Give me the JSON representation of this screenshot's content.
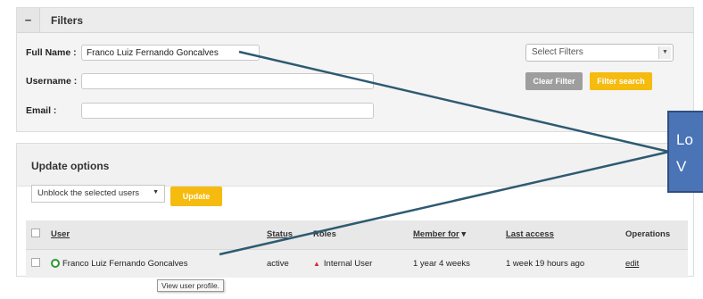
{
  "filters": {
    "title": "Filters",
    "toggle": "−",
    "full_name_label": "Full Name :",
    "full_name_value": "Franco Luiz Fernando Goncalves",
    "username_label": "Username :",
    "username_value": "",
    "email_label": "Email :",
    "email_value": "",
    "select_filters": "Select Filters",
    "clear_filter": "Clear Filter",
    "filter_search": "Filter search"
  },
  "update": {
    "title": "Update options",
    "action_selected": "Unblock the selected users",
    "update_button": "Update"
  },
  "table": {
    "headers": [
      "User",
      "Status",
      "Roles",
      "Member for",
      "Last access",
      "Operations"
    ],
    "rows": [
      {
        "user": "Franco Luiz Fernando Goncalves",
        "status": "active",
        "role": "Internal User",
        "member_for": "1 year 4 weeks",
        "last_access": "1 week 19 hours ago",
        "operation": "edit"
      }
    ]
  },
  "tooltip": "View user profile.",
  "callout": {
    "line1": "Lo",
    "line2": "V"
  },
  "colors": {
    "accent": "#f6bb0f",
    "callout": "#4a74b6",
    "arrow": "#2e5a72",
    "status_active": "#2b9a30"
  }
}
